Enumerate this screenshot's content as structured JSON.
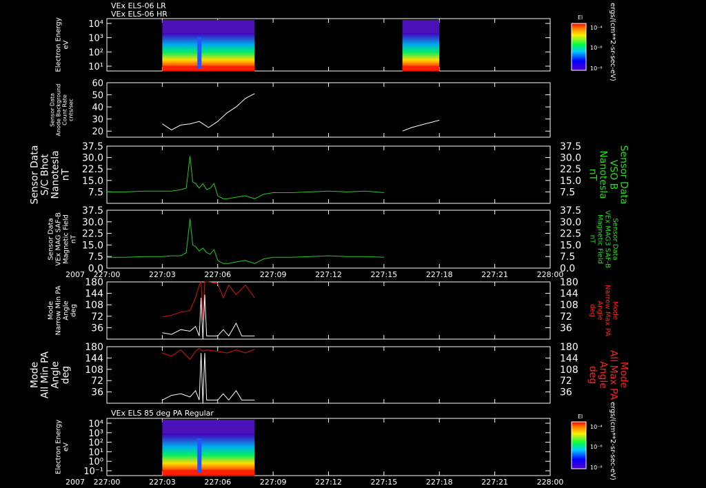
{
  "header": {
    "line1": "VEx ELS-06 LR",
    "line2": "VEx ELS-06 HR",
    "panel7_title": "VEx ELS 85 deg PA Regular"
  },
  "right_unit_label": "ergs/(cm**2-sr-sec-eV)",
  "colors": {
    "background": "#000000",
    "axis": "#ffffff",
    "green_series": "#22cc22",
    "red_series": "#dd1111",
    "white_series": "#ffffff",
    "green_label": "#22dd22",
    "red_label": "#ff2222"
  },
  "colorbar": {
    "title": "El",
    "ticks": [
      "10⁻⁴",
      "10⁻⁶",
      "10⁻⁸"
    ]
  },
  "x_axis": {
    "year": "2007",
    "ticks": [
      "227:00",
      "227:03",
      "227:06",
      "227:09",
      "227:12",
      "227:15",
      "227:18",
      "227:21",
      "228:00"
    ]
  },
  "chart_data": [
    {
      "type": "heatmap",
      "ylabel": [
        "Electron Energy",
        "eV"
      ],
      "yticks": [
        "10⁴",
        "10³",
        "10²",
        "10¹"
      ],
      "intervals": [
        [
          "227:03",
          "227:08"
        ],
        [
          "227:16",
          "227:18"
        ]
      ]
    },
    {
      "type": "line",
      "ylabel": [
        "Sensor Data",
        "Anode Background",
        "Count Rate",
        "cnts/sec"
      ],
      "ylim": [
        15,
        60
      ],
      "yticks": [
        "60",
        "50",
        "40",
        "30",
        "20"
      ],
      "series": [
        {
          "color": "white",
          "points": [
            [
              3.0,
              26
            ],
            [
              3.5,
              21
            ],
            [
              4.0,
              25
            ],
            [
              4.5,
              26
            ],
            [
              5.0,
              28
            ],
            [
              5.5,
              23
            ],
            [
              6.0,
              28
            ],
            [
              6.5,
              35
            ],
            [
              7.0,
              40
            ],
            [
              7.5,
              47
            ],
            [
              8.0,
              51
            ]
          ]
        },
        {
          "color": "white",
          "points": [
            [
              16.0,
              20
            ],
            [
              16.5,
              23
            ],
            [
              17.0,
              25
            ],
            [
              17.5,
              27
            ],
            [
              18.0,
              29
            ]
          ]
        }
      ]
    },
    {
      "type": "line",
      "ylabel": [
        "Sensor Data",
        "S/C Bhot",
        "Nanotesla",
        "nT"
      ],
      "ylabel_right": [
        "Sensor Data",
        "VSO B",
        "Nanotesla",
        "nT"
      ],
      "ylim": [
        0,
        37.5
      ],
      "yticks": [
        "37.5",
        "30.0",
        "22.5",
        "15.0",
        "7.5"
      ],
      "series": [
        {
          "color": "green",
          "points": [
            [
              0,
              7.5
            ],
            [
              1,
              7.5
            ],
            [
              2,
              8
            ],
            [
              3,
              8
            ],
            [
              3.5,
              8
            ],
            [
              4.0,
              9
            ],
            [
              4.3,
              10
            ],
            [
              4.5,
              31
            ],
            [
              4.65,
              14
            ],
            [
              4.8,
              13
            ],
            [
              5.0,
              10
            ],
            [
              5.2,
              13
            ],
            [
              5.4,
              9
            ],
            [
              5.6,
              10
            ],
            [
              5.8,
              13
            ],
            [
              6.0,
              5
            ],
            [
              6.3,
              3
            ],
            [
              6.5,
              3
            ],
            [
              7.0,
              4
            ],
            [
              7.5,
              5
            ],
            [
              8.0,
              3
            ],
            [
              8.5,
              6
            ],
            [
              9.0,
              7
            ],
            [
              10,
              7
            ],
            [
              11,
              7.5
            ],
            [
              12,
              8
            ],
            [
              13,
              7.5
            ],
            [
              14,
              8
            ],
            [
              15,
              7
            ]
          ]
        }
      ]
    },
    {
      "type": "line",
      "ylabel": [
        "Sensor Data",
        "VEx MAG SAF-B",
        "Magnetic Field",
        "nT"
      ],
      "ylabel_right": [
        "Sensor Data",
        "VEx MAG3 SAF-B",
        "Magnetic Field",
        "nT"
      ],
      "ylim": [
        0,
        37.5
      ],
      "yticks": [
        "37.5",
        "30.0",
        "22.5",
        "15.0",
        "7.5",
        "0.0"
      ],
      "series": [
        {
          "color": "green",
          "points": [
            [
              0,
              7
            ],
            [
              1,
              7
            ],
            [
              2,
              7.5
            ],
            [
              3,
              7.5
            ],
            [
              3.5,
              8
            ],
            [
              4.0,
              8
            ],
            [
              4.3,
              10
            ],
            [
              4.5,
              32
            ],
            [
              4.65,
              15
            ],
            [
              4.8,
              14
            ],
            [
              5.0,
              11
            ],
            [
              5.2,
              13
            ],
            [
              5.4,
              10
            ],
            [
              5.6,
              9
            ],
            [
              5.8,
              12
            ],
            [
              6.0,
              5
            ],
            [
              6.3,
              3
            ],
            [
              6.6,
              3
            ],
            [
              7.0,
              4
            ],
            [
              7.5,
              5
            ],
            [
              8.0,
              3
            ],
            [
              8.5,
              6
            ],
            [
              9.0,
              7
            ],
            [
              10,
              7
            ],
            [
              11,
              7.5
            ],
            [
              12,
              8
            ],
            [
              13,
              7.5
            ],
            [
              14,
              7.5
            ],
            [
              15,
              7
            ]
          ]
        }
      ]
    },
    {
      "type": "line",
      "ylabel": [
        "Mode",
        "Narrow Min PA",
        "Angle",
        "deg"
      ],
      "ylabel_right": [
        "Mode",
        "Narrow Max PA",
        "Angle",
        "deg"
      ],
      "ylim": [
        0,
        180
      ],
      "yticks": [
        "180",
        "144",
        "108",
        "72",
        "36"
      ],
      "series": [
        {
          "color": "red",
          "points": [
            [
              3.0,
              70
            ],
            [
              3.5,
              75
            ],
            [
              4.0,
              85
            ],
            [
              4.5,
              90
            ],
            [
              4.8,
              130
            ],
            [
              5.0,
              170
            ],
            [
              5.1,
              180
            ],
            [
              5.2,
              60
            ],
            [
              5.3,
              180
            ],
            [
              5.5,
              180
            ],
            [
              6.0,
              175
            ],
            [
              6.3,
              130
            ],
            [
              6.6,
              170
            ],
            [
              7.0,
              140
            ],
            [
              7.5,
              170
            ],
            [
              8.0,
              130
            ]
          ]
        },
        {
          "color": "white",
          "points": [
            [
              3.0,
              20
            ],
            [
              3.5,
              15
            ],
            [
              4.0,
              30
            ],
            [
              4.5,
              25
            ],
            [
              4.8,
              40
            ],
            [
              5.0,
              10
            ],
            [
              5.1,
              130
            ],
            [
              5.2,
              0
            ],
            [
              5.3,
              140
            ],
            [
              5.4,
              10
            ],
            [
              6.0,
              10
            ],
            [
              6.3,
              30
            ],
            [
              6.6,
              10
            ],
            [
              7.0,
              50
            ],
            [
              7.3,
              10
            ],
            [
              8.0,
              10
            ]
          ]
        }
      ]
    },
    {
      "type": "line",
      "ylabel": [
        "Mode",
        "All Min PA",
        "Angle",
        "deg"
      ],
      "ylabel_right": [
        "Mode",
        "All Max PA",
        "Angle",
        "deg"
      ],
      "ylim": [
        0,
        180
      ],
      "yticks": [
        "180",
        "144",
        "108",
        "72",
        "36"
      ],
      "series": [
        {
          "color": "red",
          "points": [
            [
              3.0,
              160
            ],
            [
              3.5,
              150
            ],
            [
              4.0,
              170
            ],
            [
              4.5,
              140
            ],
            [
              4.8,
              165
            ],
            [
              5.0,
              175
            ],
            [
              5.2,
              165
            ],
            [
              5.4,
              170
            ],
            [
              6.0,
              165
            ],
            [
              6.5,
              160
            ],
            [
              7.0,
              170
            ],
            [
              7.5,
              160
            ],
            [
              8.0,
              172
            ]
          ]
        },
        {
          "color": "white",
          "points": [
            [
              3.0,
              10
            ],
            [
              3.5,
              25
            ],
            [
              4.0,
              30
            ],
            [
              4.5,
              20
            ],
            [
              4.8,
              40
            ],
            [
              5.0,
              10
            ],
            [
              5.1,
              160
            ],
            [
              5.2,
              0
            ],
            [
              5.3,
              160
            ],
            [
              5.4,
              10
            ],
            [
              6.0,
              10
            ],
            [
              6.3,
              30
            ],
            [
              6.6,
              10
            ],
            [
              7.0,
              40
            ],
            [
              7.3,
              10
            ],
            [
              8.0,
              10
            ]
          ]
        }
      ]
    },
    {
      "type": "heatmap",
      "ylabel": [
        "Electron Energy",
        "eV"
      ],
      "yticks": [
        "10⁴",
        "10³",
        "10²",
        "10¹",
        "10⁰",
        "10⁻¹"
      ],
      "intervals": [
        [
          "227:03",
          "227:08"
        ]
      ]
    }
  ]
}
